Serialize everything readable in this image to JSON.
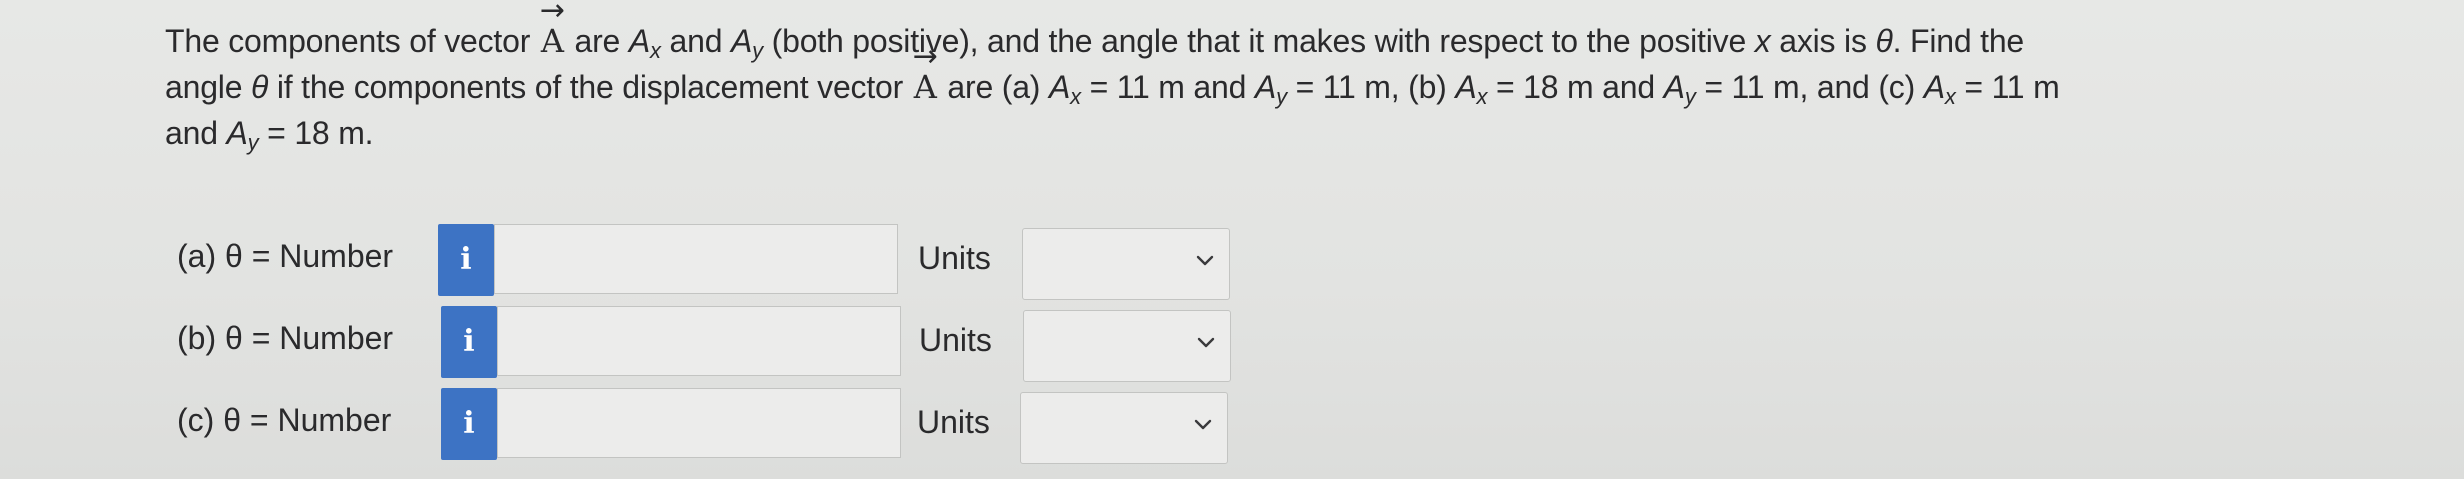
{
  "question": {
    "line1": {
      "a": "The components of vector ",
      "vec": "A",
      "b": " are ",
      "ax": "A",
      "ax_sub": "x",
      "c": " and ",
      "ay": "A",
      "ay_sub": "y",
      "d": " (both positive), and the angle that it makes with respect to the positive ",
      "xvar": "x",
      "e": " axis is ",
      "theta": "θ",
      "f": ". Find the"
    },
    "line2": {
      "a": "angle ",
      "theta": "θ",
      "b": " if the components of the displacement vector ",
      "vec": "A",
      "c": " are (a) ",
      "p1": "A",
      "p1_sub": "x",
      "p1_val": " = 11 m and ",
      "p2": "A",
      "p2_sub": "y",
      "p2_val": " = 11 m, (b) ",
      "p3": "A",
      "p3_sub": "x",
      "p3_val": " = 18 m and ",
      "p4": "A",
      "p4_sub": "y",
      "p4_val": " = 11 m, and (c) ",
      "p5": "A",
      "p5_sub": "x",
      "p5_val": " = 11 m"
    },
    "line3": {
      "a": "and ",
      "p6": "A",
      "p6_sub": "y",
      "p6_val": " = 18 m."
    },
    "arrow_glyph": "→"
  },
  "answers": [
    {
      "label": "(a)  θ = Number",
      "info": "i",
      "value": "",
      "units_label": "Units",
      "units_value": ""
    },
    {
      "label": "(b)  θ = Number",
      "info": "i",
      "value": "",
      "units_label": "Units",
      "units_value": ""
    },
    {
      "label": "(c)  θ = Number",
      "info": "i",
      "value": "",
      "units_label": "Units",
      "units_value": ""
    }
  ],
  "colors": {
    "background": "#e4e5e3",
    "info_button": "#3d73c4",
    "text": "#2a2a2c"
  },
  "icons": {
    "info": "info-icon",
    "dropdown": "chevron-down-icon"
  }
}
